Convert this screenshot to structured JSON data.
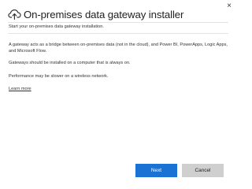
{
  "dialog": {
    "title": "On-premises data gateway installer",
    "title_icon": "cloud-upload-icon",
    "close_label": "×",
    "subtitle": "Start your on-premises data gateway installation.",
    "paragraphs": [
      "A gateway acts as a bridge between on-premises data (not in the cloud), and Power BI, PowerApps, Logic Apps, and Microsoft Flow.",
      "Gateways should be installed on a computer that is always on.",
      "Performance may be slower on a wireless network."
    ],
    "learn_more": "Learn more",
    "buttons": {
      "next": "Next",
      "cancel": "Cancel"
    },
    "colors": {
      "primary_button": "#1a73d4",
      "secondary_button": "#cfcfcf"
    }
  }
}
